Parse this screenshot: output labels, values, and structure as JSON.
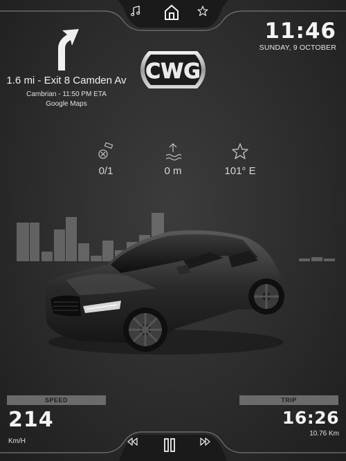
{
  "top_dock": {
    "buttons": [
      "music-icon",
      "home-icon",
      "star-icon"
    ]
  },
  "clock": {
    "time": "11:46",
    "date": "SUNDAY, 9 OCTOBER"
  },
  "navigation": {
    "maneuver_icon": "turn-right-arrow-icon",
    "instruction": "1.6 mi - Exit 8 Camden Av",
    "eta_line": "Cambrian - 11:50 PM ETA",
    "provider": "Google Maps"
  },
  "logo": {
    "text": "CWG"
  },
  "stats": [
    {
      "icon": "satellite-icon",
      "value": "0/1"
    },
    {
      "icon": "altitude-icon",
      "value": "0 m"
    },
    {
      "icon": "star-icon",
      "value": "101° E"
    }
  ],
  "speed": {
    "label": "SPEED",
    "value": "214",
    "unit": "Km/H"
  },
  "trip": {
    "label": "TRIP",
    "time": "16:26",
    "distance": "10.76 Km"
  },
  "media_controls": [
    "rewind-icon",
    "pause-icon",
    "fast-forward-icon"
  ],
  "colors": {
    "background": "#2c2c2c",
    "panel_label": "#6b6b6b",
    "text": "#eaeaea"
  }
}
